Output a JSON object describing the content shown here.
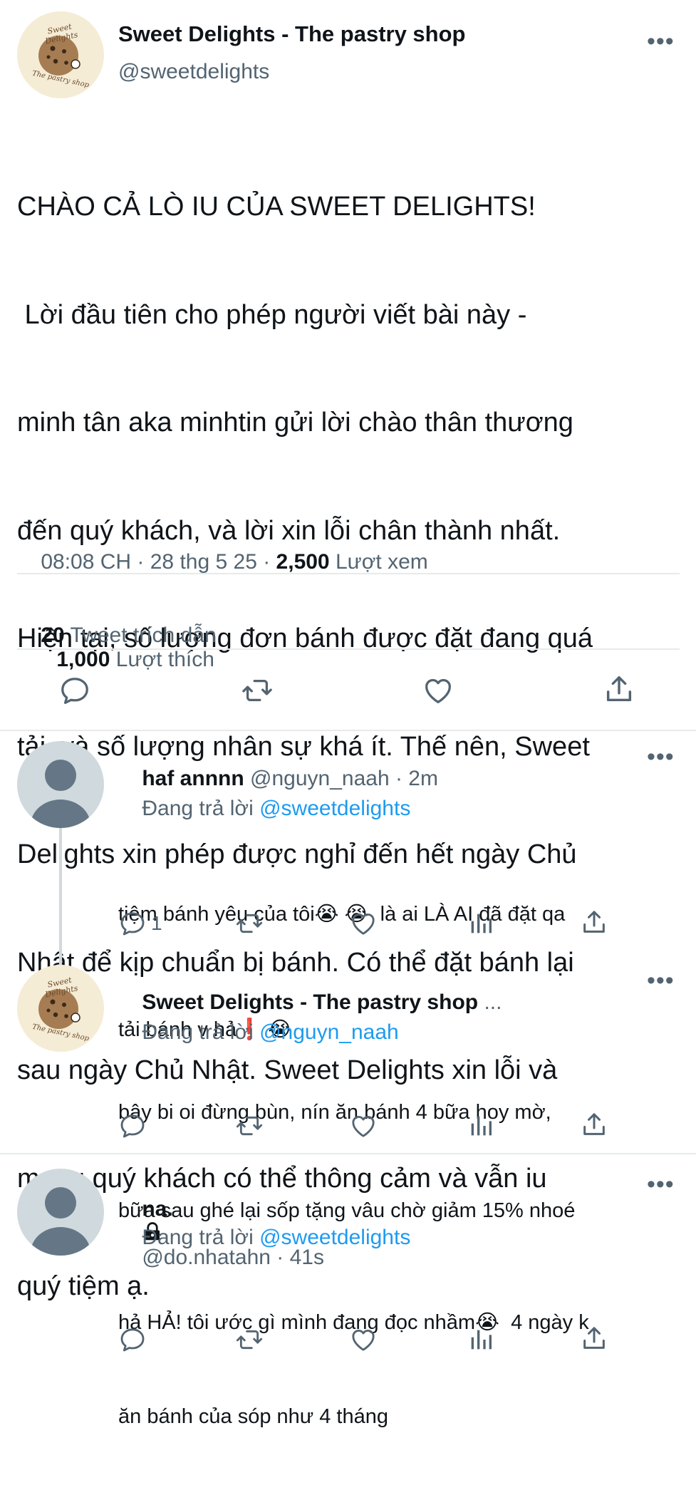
{
  "main_tweet": {
    "display_name": "Sweet Delights - The pastry shop",
    "handle": "@sweetdelights",
    "logo_text_top": "Sweet Delights",
    "logo_text_bottom": "The pastry shop",
    "text_lines": [
      "CHÀO CẢ LÒ IU CỦA SWEET DELIGHTS!",
      " Lời đầu tiên cho phép người viết bài này -",
      "minh tân aka minhtin gửi lời chào thân thương",
      "đến quý khách, và lời xin lỗi chân thành nhất.",
      "Hiện tại, số lượng đơn bánh được đặt đang quá",
      "tải, và số lượng nhân sự khá ít. Thế nên, Sweet",
      "Delights xin phép được nghỉ đến hết ngày Chủ",
      "Nhật để kịp chuẩn bị bánh. Có thể đặt bánh lại",
      "sau ngày Chủ Nhật. Sweet Delights xin lỗi và",
      "mong quý khách có thể thông cảm và vẫn iu",
      "quý tiệm ạ."
    ],
    "meta_prefix": "08:08 CH · 28 thg 5 25 · ",
    "views_count": "2,500",
    "views_label": "Lượt xem",
    "quotes_count": "20",
    "quotes_label": "Tweet trích dẫn",
    "likes_count": "1,000",
    "likes_label": "Lượt thích",
    "actions": [
      "reply-icon",
      "retweet-icon",
      "like-icon",
      "share-icon"
    ]
  },
  "replies": [
    {
      "display_name": "haf annnn",
      "handle_time": "@nguyn_naah · 2m",
      "replying_prefix": "Đang trả lời ",
      "replying_to": "@sweetdelights",
      "text_line1": "tiệm bánh yêu của tôi😭 😭  là ai LÀ AI đã đặt qa",
      "text_line2": "tải bánh v hả❗ 😭",
      "reply_count": "1",
      "actions": [
        "reply-icon",
        "retweet-icon",
        "like-icon",
        "analytics-icon",
        "share-icon"
      ]
    },
    {
      "display_name": "Sweet Delights - The pastry shop",
      "handle_time": "...",
      "replying_prefix": "Đang trả lời ",
      "replying_to": "@nguyn_naah",
      "text_line1": "bây bi oi đừng bùn, nín ăn bánh 4 bữa hoy mờ,",
      "text_line2": "bữa sau ghé lại sốp tặng vâu chờ giảm 15% nhoé",
      "reply_count": "",
      "actions": [
        "reply-icon",
        "retweet-icon",
        "like-icon",
        "analytics-icon",
        "share-icon"
      ]
    },
    {
      "display_name": "na.",
      "handle_time": "@do.nhatahn · 41s",
      "replying_prefix": "Đang trả lời ",
      "replying_to": "@sweetdelights",
      "text_line1": "hả HẢ! tôi ước gì mình đang đọc nhầm😭  4 ngày k",
      "text_line2": "ăn bánh của sóp như 4 tháng",
      "reply_count": "",
      "actions": [
        "reply-icon",
        "retweet-icon",
        "like-icon",
        "analytics-icon",
        "share-icon"
      ]
    }
  ],
  "more_label": "•••",
  "colors": {
    "link": "#1d9bf0",
    "secondary": "#536471",
    "text": "#0f1419",
    "divider": "#e7e9ea"
  }
}
